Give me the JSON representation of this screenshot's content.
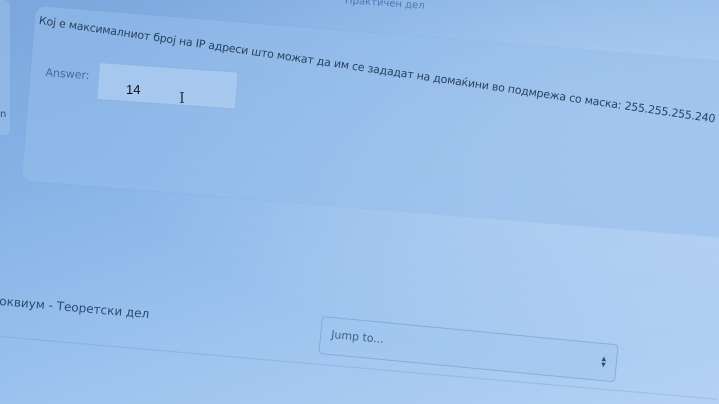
{
  "header": {
    "section_label": "Практичен дел"
  },
  "question": {
    "text": "Кој е максималниот број на IP адреси што можат да им се зададат на домаќини во подмрежа со маска: 255.255.255.240",
    "answer_label": "Answer:",
    "answer_value": "14",
    "cursor_glyph": "I"
  },
  "left_edge": {
    "glyph": "n"
  },
  "footer": {
    "course_link": "оквиум - Теоретски дел",
    "jump_select": {
      "selected": "Jump to...",
      "caret_icon": "chevron-up-down-icon"
    }
  }
}
